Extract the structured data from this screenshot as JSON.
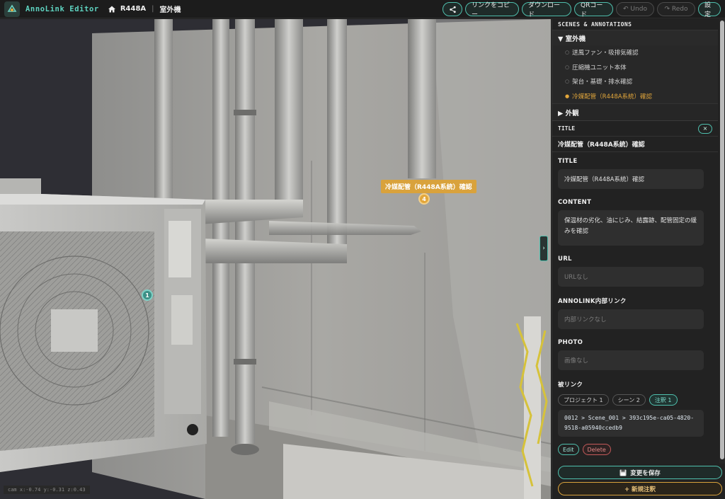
{
  "header": {
    "app_title": "AnnoLink Editor",
    "breadcrumb": [
      "R448A",
      "室外機"
    ],
    "breadcrumb_sep": "|",
    "buttons": {
      "copy_link": "リンクをコピー",
      "download": "ダウンロード",
      "qr_code": "QRコード",
      "undo": "↶ Undo",
      "redo": "↷ Redo",
      "settings": "設定"
    }
  },
  "viewport": {
    "annotation_label": "冷媒配管（R448A系統）確認",
    "markers": [
      "4",
      "1"
    ],
    "coords": "cam x:-0.74 y:-0.31 z:0.43",
    "toggle": "›"
  },
  "sidebar": {
    "section_title": "SCENES & ANNOTATIONS",
    "groups": [
      {
        "label": "▼ 室外機",
        "items": [
          "送風ファン・吸排気確認",
          "圧縮機ユニット本体",
          "架台・基礎・排水確認",
          "冷媒配管（R448A系統）確認"
        ]
      },
      {
        "label": "▶ 外観"
      }
    ],
    "detail": {
      "header_label": "TITLE",
      "close": "×",
      "selected_title": "冷媒配管（R448A系統）確認",
      "fields": {
        "title_label": "TITLE",
        "title_value": "冷媒配管（R448A系統）確認",
        "content_label": "CONTENT",
        "content_value": "保温材の劣化、油にじみ、結露跡、配管固定の緩みを確認",
        "url_label": "URL",
        "url_value": "URLなし",
        "internal_label": "ANNOLINK内部リンク",
        "internal_value": "内部リンクなし",
        "photo_label": "PHOTO",
        "photo_value": "画像なし",
        "backlink_label": "被リンク"
      },
      "chips": [
        "プロジェクト 1",
        "シーン 2",
        "注釈 1"
      ],
      "backlink_path": "0012 > Scene_001 > 393c195e-ca05-4820-9518-a05940ccedb9",
      "edit": "Edit",
      "delete": "Delete"
    },
    "footer": {
      "save": "変更を保存",
      "new_annotation": "+ 新規注釈"
    }
  },
  "colors": {
    "accent": "#4fbfad",
    "highlight": "#e3a73b",
    "danger": "#c45a5a"
  }
}
